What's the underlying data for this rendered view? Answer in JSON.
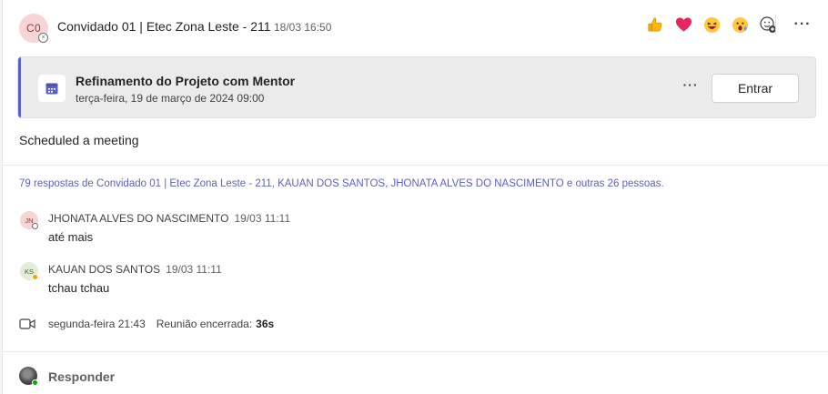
{
  "header": {
    "avatar_initials": "C0",
    "sender": "Convidado 01 | Etec Zona Leste - 211",
    "timestamp": "18/03 16:50",
    "reactions": [
      "thumbs-up-icon",
      "heart-icon",
      "laugh-icon",
      "surprised-icon",
      "add-reaction-icon"
    ],
    "more": "···"
  },
  "meeting": {
    "title": "Refinamento do Projeto com Mentor",
    "date": "terça-feira, 19 de março de 2024 09:00",
    "more": "···",
    "join_label": "Entrar",
    "accent_color": "#5b5fc7"
  },
  "message_body": "Scheduled a meeting",
  "replies_summary": "79 respostas de Convidado 01 | Etec Zona Leste - 211, KAUAN DOS SANTOS, JHONATA ALVES DO NASCIMENTO e outras 26 pessoas.",
  "replies": [
    {
      "initials": "JN",
      "name": "JHONATA ALVES DO NASCIMENTO",
      "time": "19/03 11:11",
      "text": "até mais"
    },
    {
      "initials": "KS",
      "name": "KAUAN DOS SANTOS",
      "time": "19/03 11:11",
      "text": "tchau tchau"
    }
  ],
  "meeting_ended": {
    "when": "segunda-feira 21:43",
    "label": "Reunião encerrada:",
    "duration": "36s"
  },
  "reply_button": "Responder"
}
